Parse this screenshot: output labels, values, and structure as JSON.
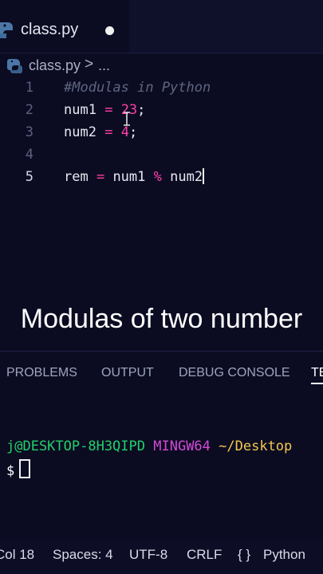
{
  "tab": {
    "label": "class.py",
    "icon": "python-icon",
    "modified_indicator": "unsaved-dot-icon"
  },
  "breadcrumb": {
    "file": "class.py",
    "separator": ">",
    "more": "..."
  },
  "editor": {
    "lines": [
      {
        "number": "1",
        "tokens": [
          {
            "t": "#Modulas in Python",
            "k": "comment"
          }
        ]
      },
      {
        "number": "2",
        "tokens": [
          {
            "t": "num1 ",
            "k": "ident"
          },
          {
            "t": "=",
            "k": "op"
          },
          {
            "t": " ",
            "k": "ident"
          },
          {
            "t": "23",
            "k": "num"
          },
          {
            "t": ";",
            "k": "punct"
          }
        ]
      },
      {
        "number": "3",
        "tokens": [
          {
            "t": "num2 ",
            "k": "ident"
          },
          {
            "t": "=",
            "k": "op"
          },
          {
            "t": " ",
            "k": "ident"
          },
          {
            "t": "4",
            "k": "num"
          },
          {
            "t": ";",
            "k": "punct"
          }
        ]
      },
      {
        "number": "4",
        "tokens": []
      },
      {
        "number": "5",
        "active": true,
        "caret": true,
        "tokens": [
          {
            "t": "rem ",
            "k": "ident"
          },
          {
            "t": "=",
            "k": "op"
          },
          {
            "t": " num1 ",
            "k": "ident"
          },
          {
            "t": "%",
            "k": "op"
          },
          {
            "t": " num2",
            "k": "ident"
          }
        ]
      }
    ]
  },
  "overlay_caption": "Modulas of two number",
  "panel": {
    "tabs": [
      {
        "label": "PROBLEMS",
        "name": "tab-problems"
      },
      {
        "label": "OUTPUT",
        "name": "tab-output"
      },
      {
        "label": "DEBUG CONSOLE",
        "name": "tab-debug-console"
      },
      {
        "label": "TE",
        "name": "tab-terminal",
        "active": true
      }
    ]
  },
  "terminal": {
    "user_host": "j@DESKTOP-8H3QIPD",
    "env": "MINGW64",
    "path": "~/Desktop",
    "prompt": "$"
  },
  "statusbar": {
    "col": "Col 18",
    "spaces": "Spaces: 4",
    "encoding": "UTF-8",
    "eol": "CRLF",
    "braces": "{ }",
    "language": "Python"
  },
  "colors": {
    "background": "#0b0c22",
    "keyword_pink": "#ff3fa6",
    "terminal_green": "#22d06b",
    "terminal_magenta": "#d449d6",
    "terminal_yellow": "#f4c84e"
  }
}
